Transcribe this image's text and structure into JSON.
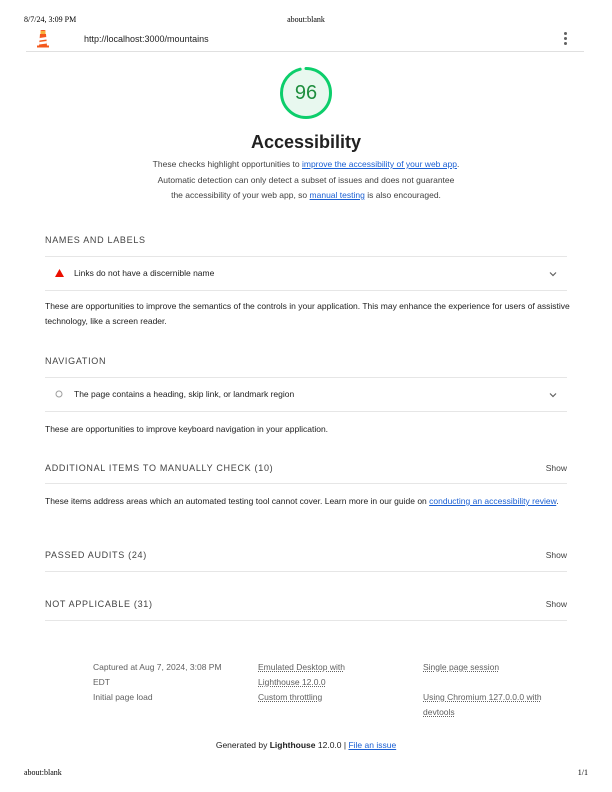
{
  "print_header": {
    "datetime": "8/7/24, 3:09 PM",
    "title": "about:blank"
  },
  "print_footer": {
    "url": "about:blank",
    "page": "1/1"
  },
  "topbar": {
    "url": "http://localhost:3000/mountains"
  },
  "score": {
    "value": "96",
    "fraction": 0.96,
    "color": "#0cce6b"
  },
  "category": {
    "title": "Accessibility",
    "desc_1": "These checks highlight opportunities to ",
    "desc_link_1": "improve the accessibility of your web app",
    "desc_2": ". Automatic detection can only detect a subset of issues and does not guarantee the accessibility of your web app, so ",
    "desc_link_2": "manual testing",
    "desc_3": " is also encouraged."
  },
  "groups": {
    "names_labels": {
      "title": "NAMES AND LABELS",
      "audit": "Links do not have a discernible name",
      "description": "These are opportunities to improve the semantics of the controls in your application. This may enhance the experience for users of assistive technology, like a screen reader."
    },
    "navigation": {
      "title": "NAVIGATION",
      "audit": "The page contains a heading, skip link, or landmark region",
      "description": "These are opportunities to improve keyboard navigation in your application."
    },
    "manual": {
      "title": "ADDITIONAL ITEMS TO MANUALLY CHECK",
      "count": "(10)",
      "show": "Show",
      "desc_1": "These items address areas which an automated testing tool cannot cover. Learn more in our guide on ",
      "desc_link": "conducting an accessibility review",
      "desc_2": "."
    },
    "passed": {
      "title": "PASSED AUDITS",
      "count": "(24)",
      "show": "Show"
    },
    "not_applicable": {
      "title": "NOT APPLICABLE",
      "count": "(31)",
      "show": "Show"
    }
  },
  "environment": {
    "captured": "Captured at Aug 7, 2024, 3:08 PM EDT",
    "load": "Initial page load",
    "emulated": "Emulated Desktop with Lighthouse 12.0.0",
    "throttling": "Custom throttling",
    "session": "Single page session",
    "browser": "Using Chromium 127.0.0.0 with devtools"
  },
  "footer": {
    "generated_by": "Generated by ",
    "tool": "Lighthouse",
    "version": " 12.0.0 | ",
    "issue_link": "File an issue"
  }
}
